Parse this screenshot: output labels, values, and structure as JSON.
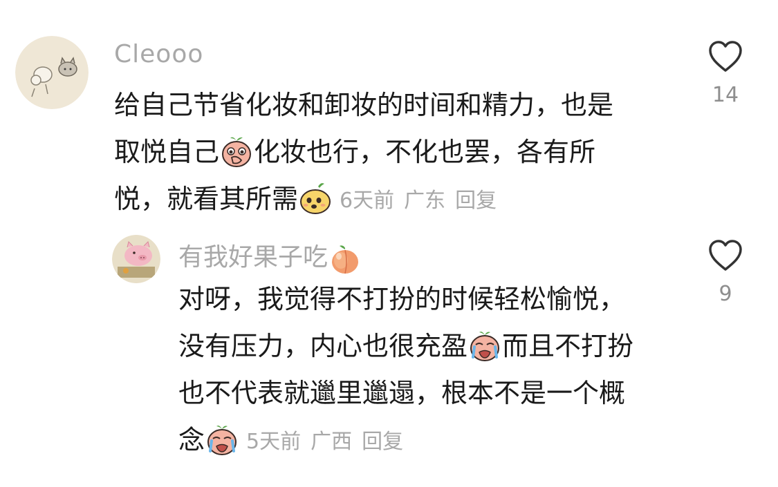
{
  "comments": [
    {
      "username": "Cleooo",
      "lines": [
        {
          "before": "给自己节省化妆和卸妆的时间和精力，也是",
          "after": ""
        },
        {
          "before": "取悦自己",
          "emoji": "peach-covering-mouth",
          "after": "化妆也行，不化也罢，各有所"
        },
        {
          "before": "悦，就看其所需",
          "emoji": "yellow-smile-face",
          "after": ""
        }
      ],
      "time": "6天前",
      "location": "广东",
      "reply": "回复",
      "likes": "14"
    },
    {
      "username": "有我好果子吃",
      "username_emoji": "peach",
      "lines": [
        {
          "before": "对呀，我觉得不打扮的时候轻松愉悦，",
          "after": ""
        },
        {
          "before": "没有压力，内心也很充盈",
          "emoji": "peach-crying",
          "after": "而且不打扮"
        },
        {
          "before": "也不代表就邋里邋遢，根本不是一个概",
          "after": ""
        },
        {
          "before": "念",
          "emoji": "peach-crying",
          "after": ""
        }
      ],
      "time": "5天前",
      "location": "广西",
      "reply": "回复",
      "likes": "9"
    }
  ],
  "colors": {
    "text": "#1a1a1a",
    "secondary": "#a8a8a8",
    "heart_outline": "#333333"
  }
}
